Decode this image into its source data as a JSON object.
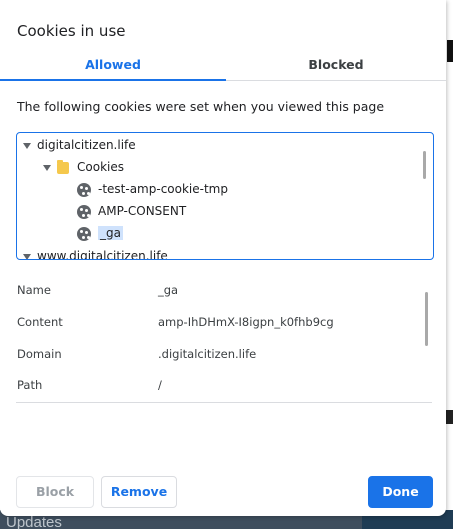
{
  "dialog": {
    "title": "Cookies in use",
    "tabs": [
      {
        "label": "Allowed",
        "active": true
      },
      {
        "label": "Blocked",
        "active": false
      }
    ],
    "description": "The following cookies were set when you viewed this page"
  },
  "tree": {
    "items": [
      {
        "label": "digitalcitizen.life",
        "type": "site",
        "expanded": true
      },
      {
        "label": "Cookies",
        "type": "folder",
        "expanded": true
      },
      {
        "label": "-test-amp-cookie-tmp",
        "type": "cookie"
      },
      {
        "label": "AMP-CONSENT",
        "type": "cookie"
      },
      {
        "label": "_ga",
        "type": "cookie",
        "selected": true
      },
      {
        "label": "www.digitalcitizen.life",
        "type": "site",
        "expanded": true
      }
    ]
  },
  "details": {
    "rows": [
      {
        "label": "Name",
        "value": "_ga"
      },
      {
        "label": "Content",
        "value": "amp-IhDHmX-I8igpn_k0fhb9cg"
      },
      {
        "label": "Domain",
        "value": ".digitalcitizen.life"
      },
      {
        "label": "Path",
        "value": "/"
      }
    ]
  },
  "buttons": {
    "block": "Block",
    "remove": "Remove",
    "done": "Done"
  },
  "background": {
    "bottom_text": "Updates"
  },
  "colors": {
    "accent": "#1a73e8",
    "selection": "#cfe2fc",
    "folder": "#f5c84c"
  }
}
